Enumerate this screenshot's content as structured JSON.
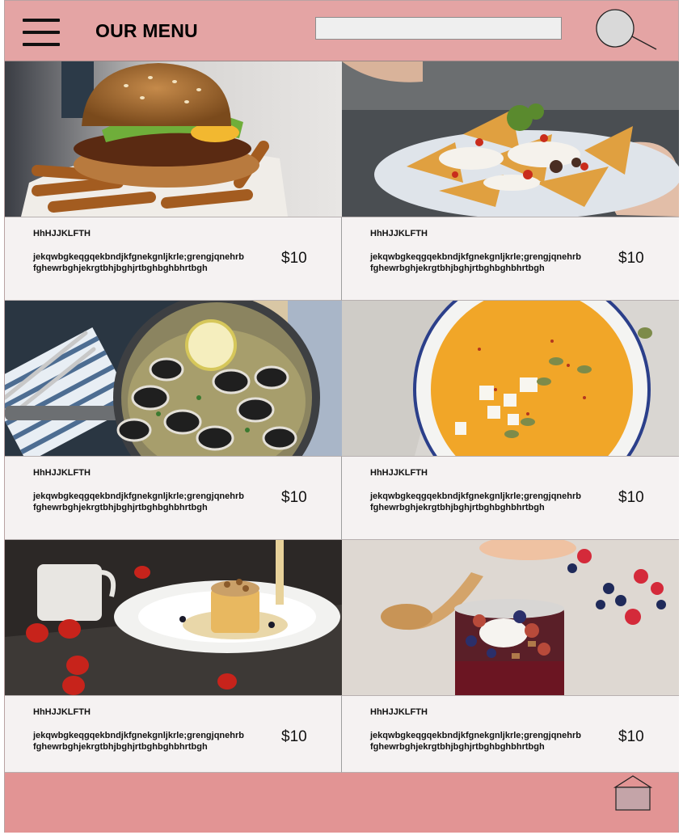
{
  "header": {
    "menu_icon": "hamburger-menu-icon",
    "title": "OUR MENU",
    "search_placeholder": "",
    "search_icon": "magnifier-icon"
  },
  "items": [
    {
      "name": "HhHJJKLFTH",
      "description": "jekqwbgkeqgqekbndjkfgnekgnljkrle;grengjqnehrbfghewrbghjekrgtbhjbghjrtbghbghbhrtbgh",
      "price": "$10",
      "image": "burger-with-fries"
    },
    {
      "name": "HhHJJKLFTH",
      "description": "jekqwbgkeqgqekbndjkfgnekgnljkrle;grengjqnehrbfghewrbghjekrgtbhjbghjrtbghbghbhrtbgh",
      "price": "$10",
      "image": "loaded-nachos"
    },
    {
      "name": "HhHJJKLFTH",
      "description": "jekqwbgkeqgqekbndjkfgnekgnljkrle;grengjqnehrbfghewrbghjekrgtbhjbghjrtbghbghbhrtbgh",
      "price": "$10",
      "image": "clams-in-pan"
    },
    {
      "name": "HhHJJKLFTH",
      "description": "jekqwbgkeqgqekbndjkfgnekgnljkrle;grengjqnehrbfghewrbghjekrgtbhjbghjrtbghbghbhrtbgh",
      "price": "$10",
      "image": "pumpkin-soup"
    },
    {
      "name": "HhHJJKLFTH",
      "description": "jekqwbgkeqgqekbndjkfgnekgnljkrle;grengjqnehrbfghewrbghjekrgtbhjbghjrtbghbghbhrtbgh",
      "price": "$10",
      "image": "cake-with-sauce"
    },
    {
      "name": "HhHJJKLFTH",
      "description": "jekqwbgkeqgqekbndjkfgnekgnljkrle;grengjqnehrbfghewrbghjekrgtbhjbghjrtbghbghbhrtbgh",
      "price": "$10",
      "image": "berry-parfait"
    }
  ],
  "footer": {
    "home_icon": "home-icon"
  },
  "colors": {
    "header_bg": "#e4a4a4",
    "footer_bg": "#e29494",
    "card_bg": "#f5f2f2",
    "home_button": "#c4a4a8"
  }
}
